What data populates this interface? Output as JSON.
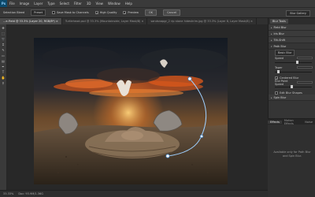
{
  "app": {
    "logo": "Ps"
  },
  "menu": [
    "File",
    "Image",
    "Layer",
    "Type",
    "Select",
    "Filter",
    "3D",
    "View",
    "Window",
    "Help"
  ],
  "options": {
    "selection_label": "Selection Bleed",
    "selection_value": "Preset",
    "save_mask_label": "Save Mask to Channels",
    "high_quality_label": "High Quality",
    "preview_label": "Preview",
    "ok_label": "OK",
    "cancel_label": "Cancel",
    "workspace": "Blur Gallery"
  },
  "tabs": [
    {
      "label": "...e-Field @ 33.3% (Layer 20, RGB/8*) ×",
      "active": true
    },
    {
      "label": "Turtlehead.psd @ 33.3% (Mountainside, Layer Mask/8) ×",
      "active": false
    },
    {
      "label": "sandsnapgr_2 rip stone hideshrim.jpg @ 33.3% (Layer 8, Layer Mask/8) ×",
      "active": false
    }
  ],
  "status": {
    "zoom": "33.33%",
    "doc": "Doc: 93.9M/1.36G"
  },
  "panel": {
    "title": "Blur Tools",
    "field_blur": "Field Blur",
    "iris_blur": "Iris Blur",
    "tilt_shift": "Tilt-Shift",
    "path_blur": "Path Blur",
    "basic_blur": "Basic Blur",
    "speed_label": "Speed",
    "taper_label": "Taper",
    "centered_blur": "Centered Blur",
    "end_point_speed": "End Point Speed",
    "edit_blur_shapes": "Edit Blur Shapes",
    "spin_blur": "Spin Blur",
    "speed_value": 0.6,
    "taper_value": 0.1,
    "end_point_value": 0.45
  },
  "panel2": {
    "tabs": [
      {
        "label": "Effects",
        "active": true
      },
      {
        "label": "Motion Effects",
        "active": false
      },
      {
        "label": "Noise",
        "active": false
      }
    ],
    "message": "Available only for Path Blur and Spin Blur."
  },
  "colors": {
    "sky_top": "#141a22",
    "fire": "#d8571c",
    "path_line": "#9fd0ff"
  }
}
